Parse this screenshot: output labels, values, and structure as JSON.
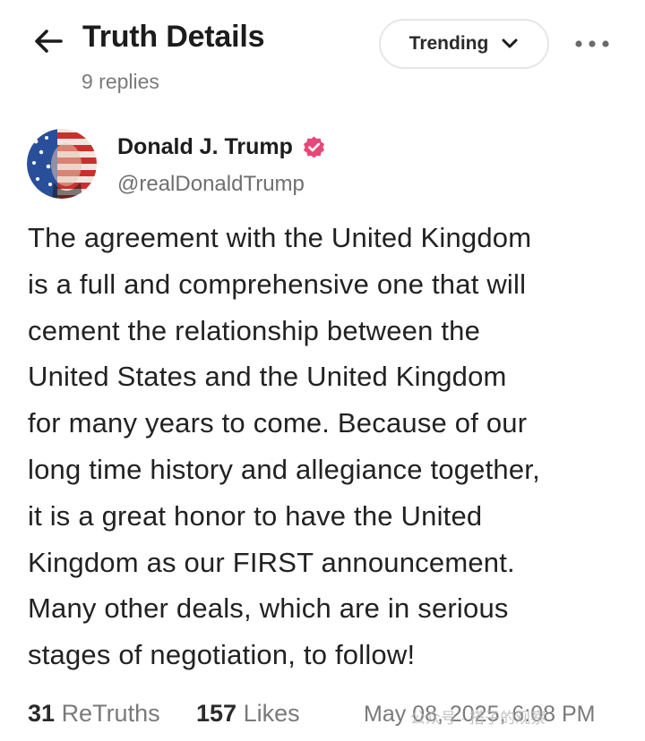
{
  "header": {
    "title": "Truth Details",
    "replies": "9 replies",
    "sort_label": "Trending",
    "back_icon": "arrow-left-icon",
    "more_icon": "ellipsis-icon"
  },
  "author": {
    "name": "Donald J. Trump",
    "handle": "@realDonaldTrump",
    "verified_color": "#e8477a"
  },
  "post": {
    "lines": [
      "The agreement with the United Kingdom",
      "is a full and comprehensive one that will",
      "cement the relationship between the",
      "United States and the United Kingdom",
      "for many years to come. Because of our",
      "long time history and allegiance together,",
      "it is a great honor to have the United",
      "Kingdom as our FIRST announcement.",
      "Many other deals, which are in serious",
      "stages of negotiation, to follow!"
    ]
  },
  "stats": {
    "retruths_count": "31",
    "retruths_label": "ReTruths",
    "likes_count": "157",
    "likes_label": "Likes",
    "timestamp": "May 08, 2025, 6:08 PM"
  },
  "watermark": "公众号 · 搭子的观察"
}
